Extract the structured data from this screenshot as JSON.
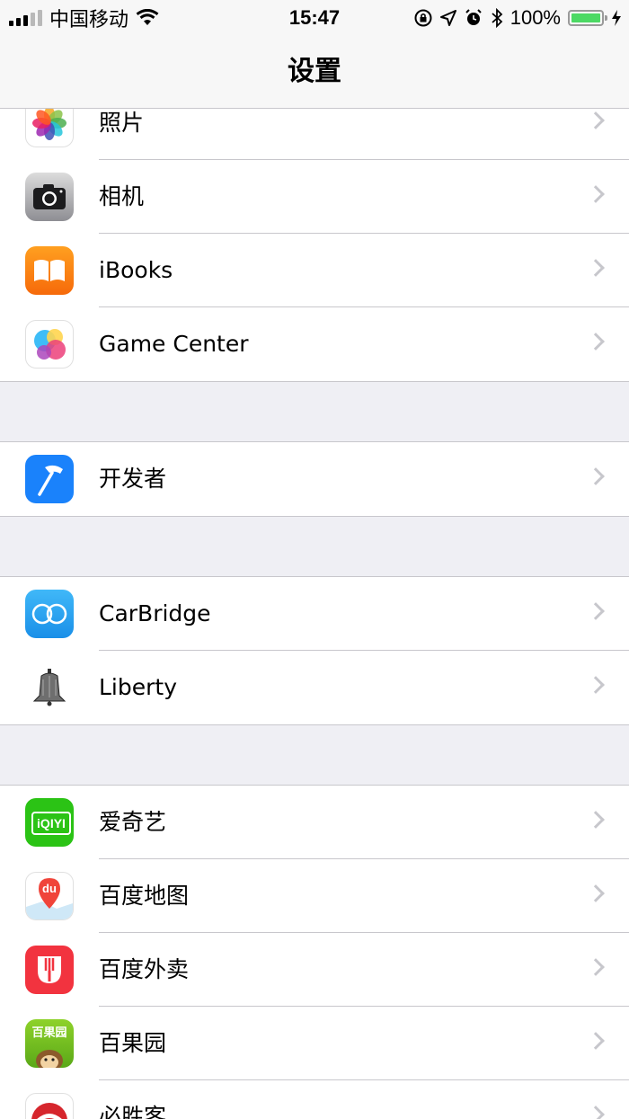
{
  "status_bar": {
    "carrier": "中国移动",
    "time": "15:47",
    "battery_percent": "100%"
  },
  "nav": {
    "title": "设置"
  },
  "groups": [
    {
      "rows": [
        {
          "label": "照片",
          "icon": "photos-icon"
        },
        {
          "label": "相机",
          "icon": "camera-icon"
        },
        {
          "label": "iBooks",
          "icon": "ibooks-icon"
        },
        {
          "label": "Game Center",
          "icon": "game-center-icon"
        }
      ]
    },
    {
      "rows": [
        {
          "label": "开发者",
          "icon": "developer-hammer-icon"
        }
      ]
    },
    {
      "rows": [
        {
          "label": "CarBridge",
          "icon": "carbridge-icon"
        },
        {
          "label": "Liberty",
          "icon": "liberty-bell-icon"
        }
      ]
    },
    {
      "rows": [
        {
          "label": "爱奇艺",
          "icon": "iqiyi-icon",
          "icon_text": "iQIYI"
        },
        {
          "label": "百度地图",
          "icon": "baidu-maps-icon",
          "icon_text": "du"
        },
        {
          "label": "百度外卖",
          "icon": "baidu-waimai-icon"
        },
        {
          "label": "百果园",
          "icon": "baiguoyuan-icon",
          "icon_text": "百果园"
        },
        {
          "label": "必胜客",
          "icon": "pizza-hut-icon"
        }
      ]
    }
  ],
  "colors": {
    "background": "#efeff4",
    "separator": "#c8c7cc",
    "chevron": "#c7c7cc",
    "battery_green": "#4cd964"
  }
}
